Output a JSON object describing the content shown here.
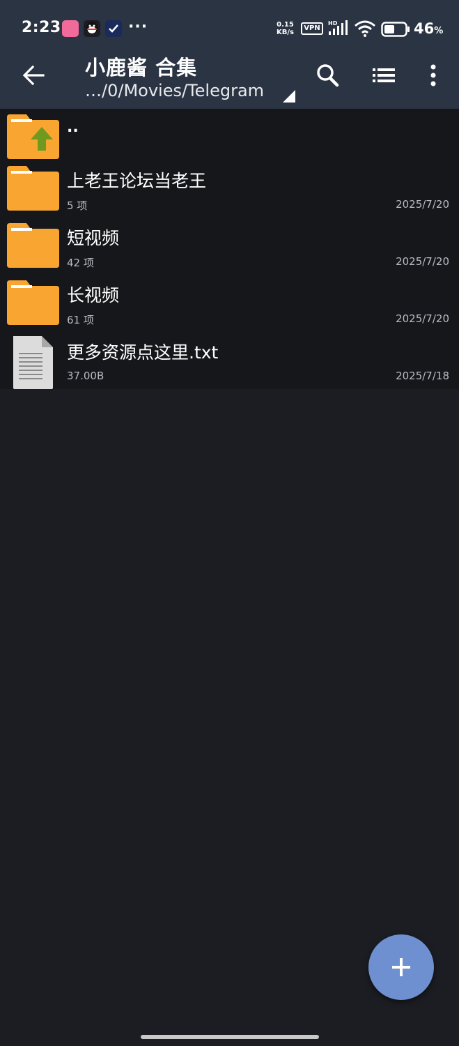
{
  "status_bar": {
    "time": "2:23",
    "net_speed_value": "0.15",
    "net_speed_unit": "KB/s",
    "vpn_label": "VPN",
    "hd_label": "HD",
    "battery_percent": "46",
    "battery_unit": "%",
    "more_notifications": "···"
  },
  "toolbar": {
    "title": "小鹿酱 合集",
    "path": "…/0/Movies/Telegram"
  },
  "files": {
    "parent": {
      "name": ".."
    },
    "items": [
      {
        "type": "folder",
        "name": "上老王论坛当老王",
        "meta": "5 项",
        "date": "2025/7/20"
      },
      {
        "type": "folder",
        "name": "短视频",
        "meta": "42 项",
        "date": "2025/7/20"
      },
      {
        "type": "folder",
        "name": "长视频",
        "meta": "61 项",
        "date": "2025/7/20"
      },
      {
        "type": "file",
        "name": "更多资源点这里.txt",
        "meta": "37.00B",
        "date": "2025/7/18"
      }
    ]
  },
  "fab": {
    "label": "+"
  },
  "colors": {
    "toolbar_bg": "#2b3443",
    "list_bg": "#16171b",
    "page_bg": "#1b1d22",
    "folder": "#f9a531",
    "fab": "#6e8fd0"
  }
}
